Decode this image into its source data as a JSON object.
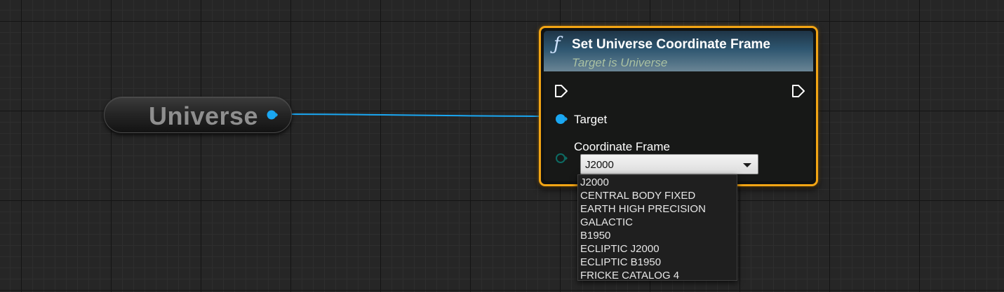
{
  "variable_node": {
    "label": "Universe",
    "pin_color": "#1aa7f2"
  },
  "wire": {
    "color": "#1aa7f2"
  },
  "function_node": {
    "icon": "function-icon",
    "title": "Set Universe Coordinate Frame",
    "subtitle": "Target is Universe",
    "border_color": "#f3a514",
    "pins": {
      "exec_in": "exec-in-pin-icon",
      "exec_out": "exec-out-pin-icon",
      "target_label": "Target",
      "coordinate_frame_label": "Coordinate Frame"
    },
    "coordinate_frame_value": "J2000"
  },
  "dropdown": {
    "items": [
      "J2000",
      "CENTRAL BODY FIXED",
      "EARTH HIGH PRECISION",
      "GALACTIC",
      "B1950",
      "ECLIPTIC J2000",
      "ECLIPTIC B1950",
      "FRICKE CATALOG 4"
    ]
  }
}
